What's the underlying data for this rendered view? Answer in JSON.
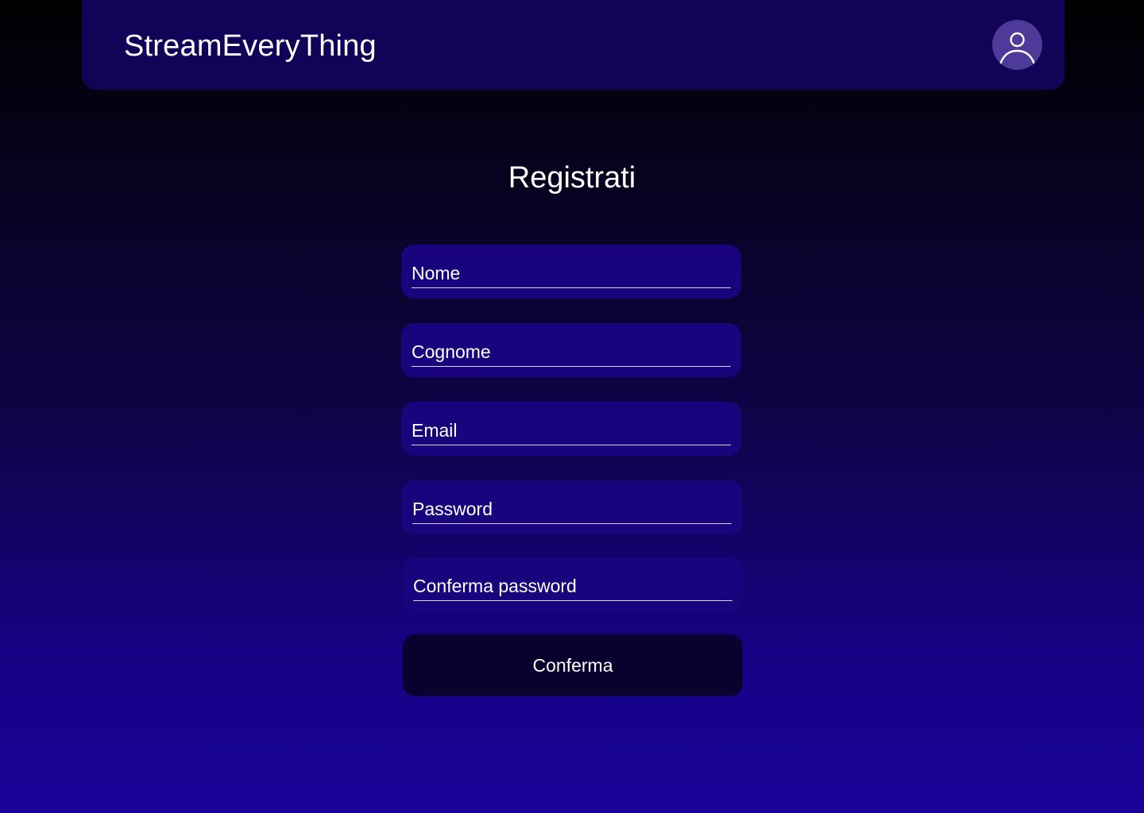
{
  "header": {
    "brand": "StreamEveryThing",
    "avatar_icon": "user-icon"
  },
  "form": {
    "title": "Registrati",
    "fields": [
      {
        "label": "Nome"
      },
      {
        "label": "Cognome"
      },
      {
        "label": "Email"
      },
      {
        "label": "Password"
      },
      {
        "label": "Conferma password"
      }
    ],
    "submit_label": "Conferma"
  },
  "colors": {
    "header_bg": "#110358",
    "field_bg": "#1a047e",
    "button_bg": "#08022f",
    "avatar_bg": "#4e3a98",
    "gradient_top": "#000000",
    "gradient_bottom": "#1a0299"
  }
}
